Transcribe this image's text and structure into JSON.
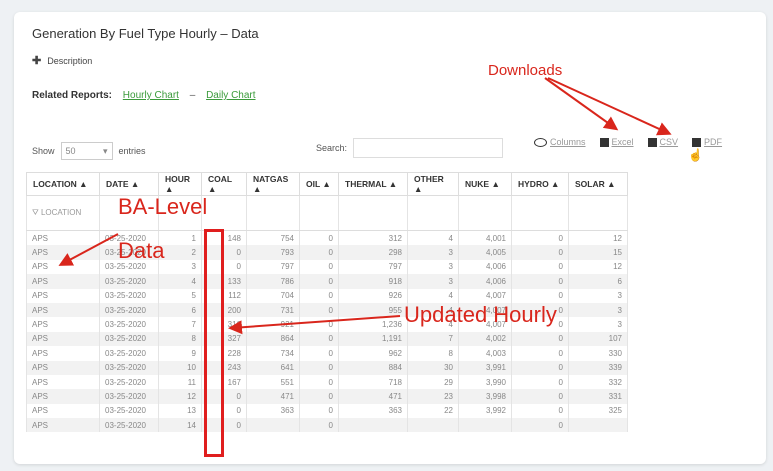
{
  "report": {
    "title": "Generation By Fuel Type Hourly – Data",
    "description_label": "Description",
    "related_label": "Related Reports:",
    "related_links": [
      "Hourly Chart",
      "Daily Chart"
    ],
    "related_sep": "–"
  },
  "controls": {
    "show_label": "Show",
    "entries_value": "50",
    "entries_label": "entries",
    "search_label": "Search:",
    "columns_label": "Columns",
    "excel_label": "Excel",
    "csv_label": "CSV",
    "pdf_label": "PDF"
  },
  "table": {
    "columns": [
      "LOCATION ▲",
      "DATE ▲",
      "HOUR ▲",
      "COAL ▲",
      "NATGAS ▲",
      "OIL ▲",
      "THERMAL ▲",
      "OTHER ▲",
      "NUKE ▲",
      "HYDRO ▲",
      "SOLAR ▲"
    ],
    "filter_placeholder": "LOCATION",
    "rows": [
      [
        "APS",
        "03-25-2020",
        "1",
        "148",
        "754",
        "0",
        "312",
        "4",
        "4,001",
        "0",
        "12"
      ],
      [
        "APS",
        "03-25-2020",
        "2",
        "0",
        "793",
        "0",
        "298",
        "3",
        "4,005",
        "0",
        "15"
      ],
      [
        "APS",
        "03-25-2020",
        "3",
        "0",
        "797",
        "0",
        "797",
        "3",
        "4,006",
        "0",
        "12"
      ],
      [
        "APS",
        "03-25-2020",
        "4",
        "133",
        "786",
        "0",
        "918",
        "3",
        "4,006",
        "0",
        "6"
      ],
      [
        "APS",
        "03-25-2020",
        "5",
        "112",
        "704",
        "0",
        "926",
        "4",
        "4,007",
        "0",
        "3"
      ],
      [
        "APS",
        "03-25-2020",
        "6",
        "200",
        "731",
        "0",
        "955",
        "4",
        "4,007",
        "0",
        "3"
      ],
      [
        "APS",
        "03-25-2020",
        "7",
        "316",
        "921",
        "0",
        "1,236",
        "4",
        "4,007",
        "0",
        "3"
      ],
      [
        "APS",
        "03-25-2020",
        "8",
        "327",
        "864",
        "0",
        "1,191",
        "7",
        "4,002",
        "0",
        "107"
      ],
      [
        "APS",
        "03-25-2020",
        "9",
        "228",
        "734",
        "0",
        "962",
        "8",
        "4,003",
        "0",
        "330"
      ],
      [
        "APS",
        "03-25-2020",
        "10",
        "243",
        "641",
        "0",
        "884",
        "30",
        "3,991",
        "0",
        "339"
      ],
      [
        "APS",
        "03-25-2020",
        "11",
        "167",
        "551",
        "0",
        "718",
        "29",
        "3,990",
        "0",
        "332"
      ],
      [
        "APS",
        "03-25-2020",
        "12",
        "0",
        "471",
        "0",
        "471",
        "23",
        "3,998",
        "0",
        "331"
      ],
      [
        "APS",
        "03-25-2020",
        "13",
        "0",
        "363",
        "0",
        "363",
        "22",
        "3,992",
        "0",
        "325"
      ],
      [
        "APS",
        "03-25-2020",
        "14",
        "0",
        "",
        "0",
        "",
        "",
        "",
        "0",
        ""
      ]
    ]
  },
  "annotations": {
    "downloads": "Downloads",
    "ba_level_line1": "BA-Level",
    "ba_level_line2": "Data",
    "updated_hourly": "Updated Hourly",
    "color": "#d9261c"
  }
}
